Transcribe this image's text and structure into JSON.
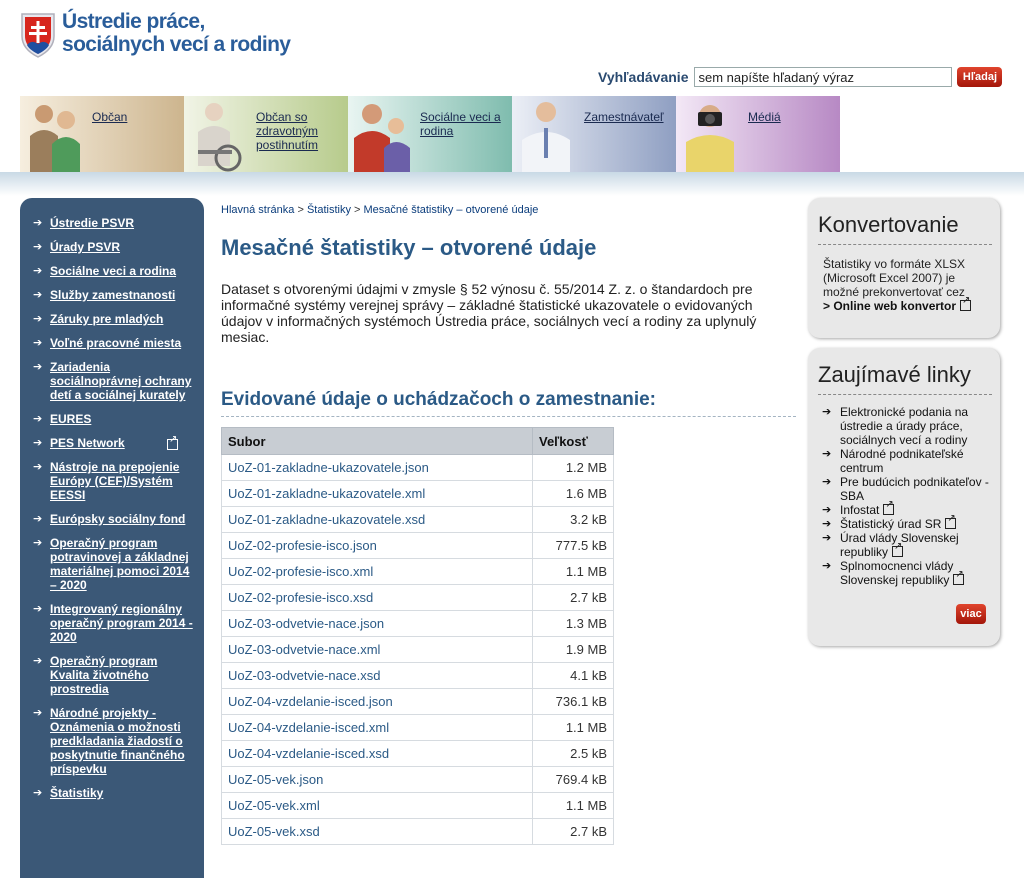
{
  "header": {
    "logo_line1": "Ústredie práce,",
    "logo_line2": "sociálnych vecí a rodiny"
  },
  "search": {
    "label": "Vyhľadávanie",
    "value": "sem napíšte hľadaný výraz",
    "button": "Hľadaj"
  },
  "nav": {
    "tabs": [
      {
        "label": "Občan"
      },
      {
        "label": "Občan so zdravotným postihnutím"
      },
      {
        "label": "Sociálne veci a rodina"
      },
      {
        "label": "Zamestnávateľ"
      },
      {
        "label": "Médiá"
      }
    ]
  },
  "sidebar": {
    "items": [
      {
        "label": "Ústredie PSVR"
      },
      {
        "label": "Úrady PSVR"
      },
      {
        "label": "Sociálne veci a rodina"
      },
      {
        "label": "Služby zamestnanosti"
      },
      {
        "label": "Záruky pre mladých"
      },
      {
        "label": "Voľné pracovné miesta"
      },
      {
        "label": "Zariadenia sociálnoprávnej ochrany detí a sociálnej kurately"
      },
      {
        "label": "EURES"
      },
      {
        "label": "PES Network"
      },
      {
        "label": "Nástroje na prepojenie Európy (CEF)/Systém EESSI"
      },
      {
        "label": "Európsky sociálny fond"
      },
      {
        "label": "Operačný program potravinovej a základnej materiálnej pomoci 2014 – 2020"
      },
      {
        "label": "Integrovaný regionálny operačný program 2014 - 2020"
      },
      {
        "label": "Operačný program Kvalita životného prostredia"
      },
      {
        "label": "Národné projekty - Oznámenia o možnosti predkladania žiadostí o poskytnutie finančného príspevku"
      },
      {
        "label": "Štatistiky"
      }
    ]
  },
  "breadcrumb": {
    "home": "Hlavná stránka",
    "sep": ">",
    "stats": "Štatistiky",
    "current": "Mesačné štatistiky – otvorené údaje"
  },
  "main": {
    "title": "Mesačné štatistiky – otvorené údaje",
    "intro": "Dataset s otvorenými údajmi v zmysle § 52 výnosu č. 55/2014 Z. z. o štandardoch pre informačné systémy verejnej správy – základné štatistické ukazovatele o evidovaných údajov v informačných systémoch Ústredia práce, sociálnych vecí a rodiny za uplynulý mesiac.",
    "section_title": "Evidované údaje o uchádzačoch o zamestnanie:"
  },
  "table": {
    "headers": {
      "file": "Subor",
      "size": "Veľkosť"
    },
    "rows": [
      {
        "file": "UoZ-01-zakladne-ukazovatele.json",
        "size": "1.2 MB"
      },
      {
        "file": "UoZ-01-zakladne-ukazovatele.xml",
        "size": "1.6 MB"
      },
      {
        "file": "UoZ-01-zakladne-ukazovatele.xsd",
        "size": "3.2 kB"
      },
      {
        "file": "UoZ-02-profesie-isco.json",
        "size": "777.5 kB"
      },
      {
        "file": "UoZ-02-profesie-isco.xml",
        "size": "1.1 MB"
      },
      {
        "file": "UoZ-02-profesie-isco.xsd",
        "size": "2.7 kB"
      },
      {
        "file": "UoZ-03-odvetvie-nace.json",
        "size": "1.3 MB"
      },
      {
        "file": "UoZ-03-odvetvie-nace.xml",
        "size": "1.9 MB"
      },
      {
        "file": "UoZ-03-odvetvie-nace.xsd",
        "size": "4.1 kB"
      },
      {
        "file": "UoZ-04-vzdelanie-isced.json",
        "size": "736.1 kB"
      },
      {
        "file": "UoZ-04-vzdelanie-isced.xml",
        "size": "1.1 MB"
      },
      {
        "file": "UoZ-04-vzdelanie-isced.xsd",
        "size": "2.5 kB"
      },
      {
        "file": "UoZ-05-vek.json",
        "size": "769.4 kB"
      },
      {
        "file": "UoZ-05-vek.xml",
        "size": "1.1 MB"
      },
      {
        "file": "UoZ-05-vek.xsd",
        "size": "2.7 kB"
      }
    ]
  },
  "converter_box": {
    "title": "Konvertovanie",
    "text": "Štatistiky vo formáte XLSX (Microsoft Excel 2007) je možné prekonvertovať cez",
    "link": "> Online web konvertor"
  },
  "links_box": {
    "title": "Zaujímavé linky",
    "items": [
      {
        "label": "Elektronické podania na ústredie a úrady práce, sociálnych vecí a rodiny"
      },
      {
        "label": "Národné podnikateľské centrum"
      },
      {
        "label": "Pre budúcich podnikateľov - SBA"
      },
      {
        "label": "Infostat"
      },
      {
        "label": "Štatistický úrad SR"
      },
      {
        "label": "Úrad vlády Slovenskej republiky"
      },
      {
        "label": "Splnomocnenci vlády Slovenskej republiky"
      }
    ],
    "more": "viac"
  }
}
